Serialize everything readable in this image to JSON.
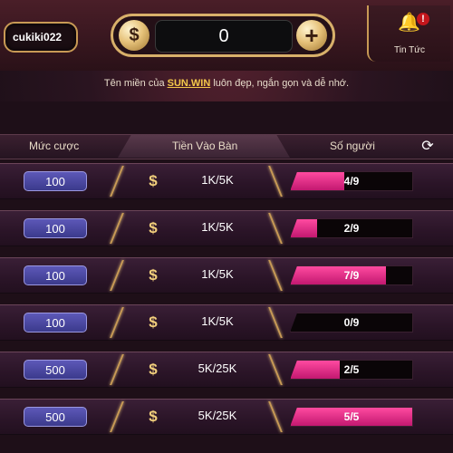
{
  "header": {
    "username": "cukiki022",
    "balance": "0",
    "news_label": "Tin Tức"
  },
  "notice": {
    "prefix": "Tên miền của ",
    "brand": "SUN.WIN",
    "suffix": " luôn đẹp, ngắn gọn và dễ nhớ."
  },
  "table": {
    "col_bet": "Mức cược",
    "col_entry": "Tiền Vào Bàn",
    "col_players": "Số người",
    "rows": [
      {
        "bet": "100",
        "entry": "1K/5K",
        "players": "4/9",
        "fill": 0.44
      },
      {
        "bet": "100",
        "entry": "1K/5K",
        "players": "2/9",
        "fill": 0.22
      },
      {
        "bet": "100",
        "entry": "1K/5K",
        "players": "7/9",
        "fill": 0.78
      },
      {
        "bet": "100",
        "entry": "1K/5K",
        "players": "0/9",
        "fill": 0.0
      },
      {
        "bet": "500",
        "entry": "5K/25K",
        "players": "2/5",
        "fill": 0.4
      },
      {
        "bet": "500",
        "entry": "5K/25K",
        "players": "5/5",
        "fill": 1.0
      }
    ]
  },
  "colors": {
    "accent_gold": "#c89a55",
    "bar_fill": "#e0308a",
    "bet_pill": "#4a46a6"
  },
  "icons": {
    "coin": "dollar-coin-icon",
    "plus": "plus-icon",
    "bell": "bell-icon",
    "refresh": "refresh-icon"
  }
}
